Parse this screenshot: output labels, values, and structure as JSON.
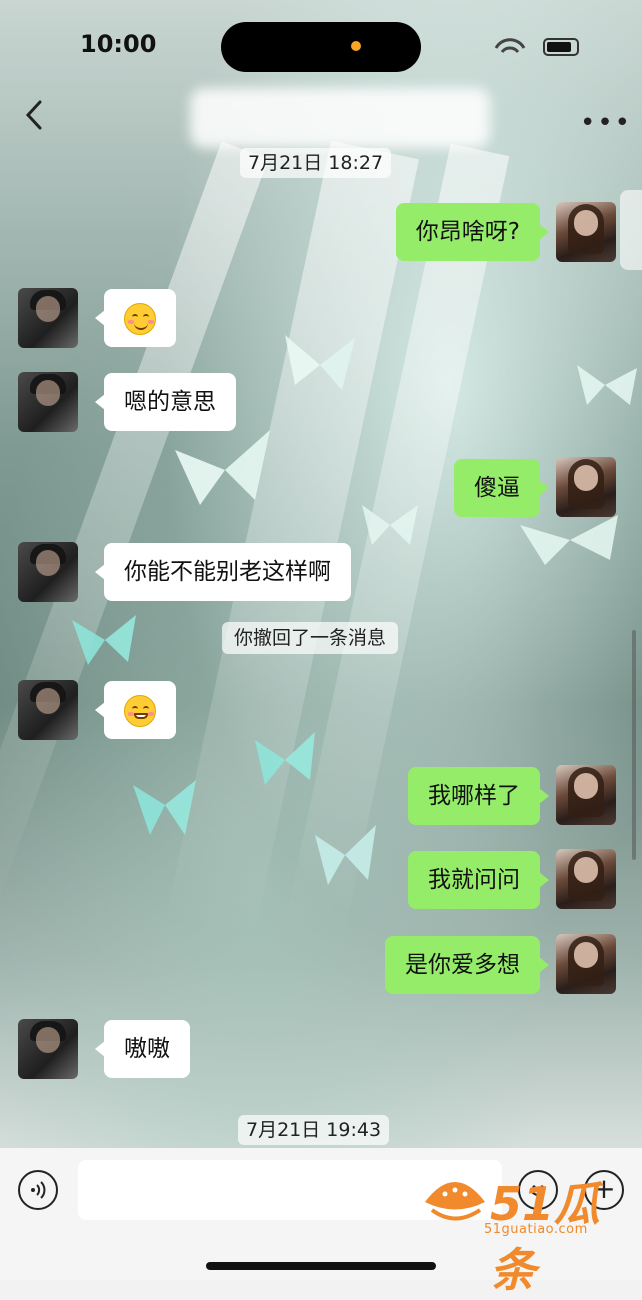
{
  "status_bar": {
    "time": "10:00"
  },
  "nav": {
    "back_icon": "chevron-left-icon",
    "more_icon": "more-icon",
    "more_label": "•••"
  },
  "timestamps": {
    "top": "7月21日 18:27",
    "bottom": "7月21日 19:43"
  },
  "messages": [
    {
      "side": "out",
      "text": "你昂啥呀?"
    },
    {
      "side": "in",
      "emoji": "smiling-face-icon"
    },
    {
      "side": "in",
      "text": "嗯的意思"
    },
    {
      "side": "out",
      "text": "傻逼"
    },
    {
      "side": "in",
      "text": "你能不能别老这样啊"
    },
    {
      "side": "in",
      "emoji": "grinning-face-icon"
    },
    {
      "side": "out",
      "text": "我哪样了"
    },
    {
      "side": "out",
      "text": "我就问问"
    },
    {
      "side": "out",
      "text": "是你爱多想"
    },
    {
      "side": "in",
      "text": "嗷嗷"
    }
  ],
  "system_notice": "你撤回了一条消息",
  "input_bar": {
    "voice_icon": "voice-icon",
    "emoji_icon": "emoji-icon",
    "plus_icon": "plus-icon",
    "plus_label": "+"
  },
  "watermark": {
    "brand": "51瓜条",
    "url": "51guatiao.com"
  },
  "colors": {
    "out_bubble": "#95ec69",
    "in_bubble": "#ffffff",
    "watermark": "#f08a2c"
  }
}
